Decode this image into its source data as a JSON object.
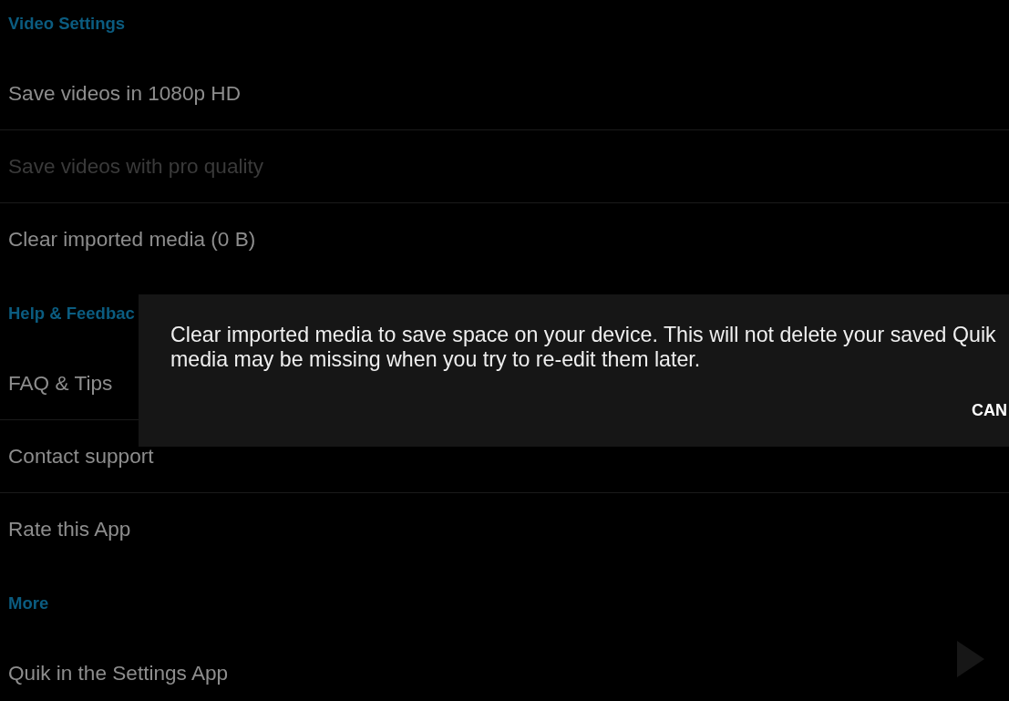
{
  "sections": [
    {
      "header": "Video Settings",
      "items": [
        {
          "label": "Save videos in 1080p HD",
          "disabled": false
        },
        {
          "label": "Save videos with pro quality",
          "disabled": true
        },
        {
          "label": "Clear imported media (0 B)",
          "disabled": false
        }
      ]
    },
    {
      "header": "Help & Feedbac",
      "items": [
        {
          "label": "FAQ & Tips",
          "disabled": false
        },
        {
          "label": "Contact support",
          "disabled": false
        },
        {
          "label": "Rate this App",
          "disabled": false
        }
      ]
    },
    {
      "header": "More",
      "items": [
        {
          "label": "Quik in the Settings App",
          "disabled": false
        }
      ]
    }
  ],
  "dialog": {
    "message_lines": [
      "Clear imported media to save space on your device. This will not delete your saved Quik",
      "media may be missing when you try to re-edit them later."
    ],
    "buttons": [
      "CAN"
    ]
  }
}
